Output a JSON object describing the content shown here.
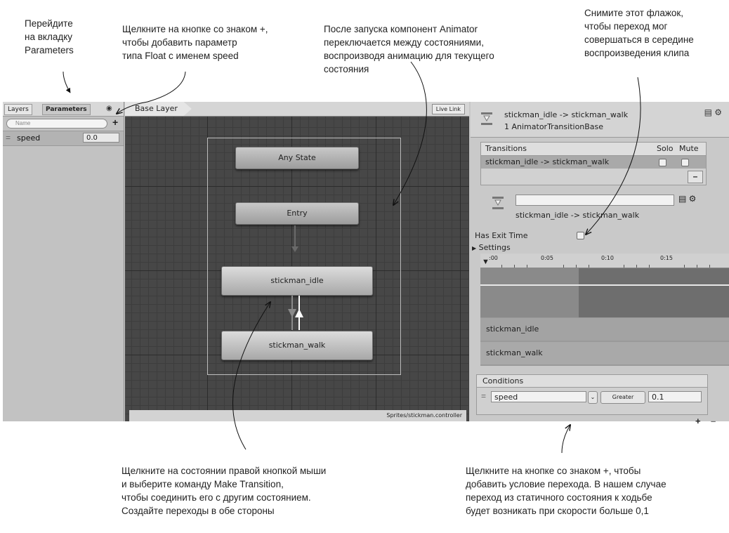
{
  "callouts": {
    "params_tab": "Перейдите\nна вкладку\nParameters",
    "plus_param": "Щелкните на кнопке со знаком +,\nчтобы добавить параметр\nтипа Float с именем speed",
    "animator_run": "После запуска компонент Animator\nпереключается между состояниями,\nвоспроизводя анимацию для текущего\nсостояния",
    "exit_time": "Снимите этот флажок,\nчтобы переход мог\nсовершаться в середине\nвоспроизведения клипа",
    "make_transition": "Щелкните на состоянии правой кнопкой мыши\nи выберите команду Make Transition,\nчтобы соединить его с другим состоянием.\nСоздайте переходы в обе стороны",
    "add_condition": "Щелкните на кнопке со знаком +, чтобы\nдобавить условие перехода. В нашем случае\nпереход из статичного состояния к ходьбе\nбудет возникать при скорости больше 0,1"
  },
  "left_panel": {
    "tabs": [
      "Layers",
      "Parameters"
    ],
    "search_placeholder": "Name",
    "add_label": "+",
    "parameter": {
      "name": "speed",
      "value": "0.0"
    }
  },
  "graph": {
    "breadcrumb": "Base Layer",
    "live_link": "Live Link",
    "states": {
      "any": "Any State",
      "entry": "Entry",
      "idle": "stickman_idle",
      "walk": "stickman_walk"
    },
    "footer": "Sprites/stickman.controller"
  },
  "inspector": {
    "title": "stickman_idle -> stickman_walk",
    "subtitle": "1 AnimatorTransitionBase",
    "transitions_header": "Transitions",
    "solo": "Solo",
    "mute": "Mute",
    "transition_row": "stickman_idle -> stickman_walk",
    "minus": "–",
    "sub_title": "stickman_idle -> stickman_walk",
    "has_exit_time": "Has Exit Time",
    "settings": "Settings",
    "ruler": [
      ":00",
      "0:05",
      "0:10",
      "0:15"
    ],
    "clips": [
      "stickman_idle",
      "stickman_walk"
    ],
    "conditions_header": "Conditions",
    "condition": {
      "param": "speed",
      "op": "Greater",
      "value": "0.1"
    },
    "plus": "+",
    "minus2": "–"
  },
  "colors": {
    "graph_bg": "#474747",
    "state_fill": "#b4b4b4",
    "panel_bg": "#c7c7c7"
  }
}
